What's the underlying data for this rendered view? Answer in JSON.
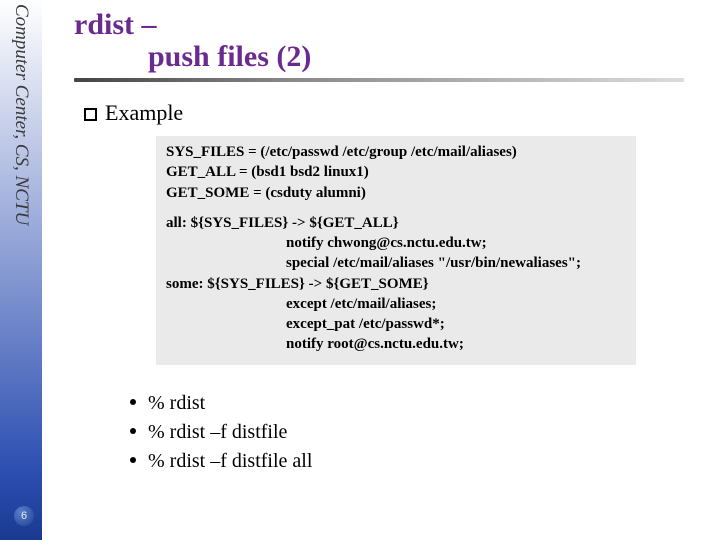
{
  "sidebar": {
    "label": "Computer Center, CS, NCTU",
    "slide_number": "6"
  },
  "title": {
    "line1": "rdist –",
    "line2": "push files (2)"
  },
  "section": {
    "heading": "Example"
  },
  "codebox": {
    "l1": "SYS_FILES = (/etc/passwd /etc/group /etc/mail/aliases)",
    "l2": "GET_ALL = (bsd1 bsd2 linux1)",
    "l3": "GET_SOME = (csduty alumni)",
    "l4": "all: ${SYS_FILES} -> ${GET_ALL}",
    "l5": "notify chwong@cs.nctu.edu.tw;",
    "l6": "special /etc/mail/aliases \"/usr/bin/newaliases\";",
    "l7": "some: ${SYS_FILES} -> ${GET_SOME}",
    "l8": "except /etc/mail/aliases;",
    "l9": "except_pat /etc/passwd*;",
    "l10": "notify root@cs.nctu.edu.tw;"
  },
  "commands": {
    "c1": "% rdist",
    "c2": "% rdist –f distfile",
    "c3": "% rdist –f distfile all"
  }
}
